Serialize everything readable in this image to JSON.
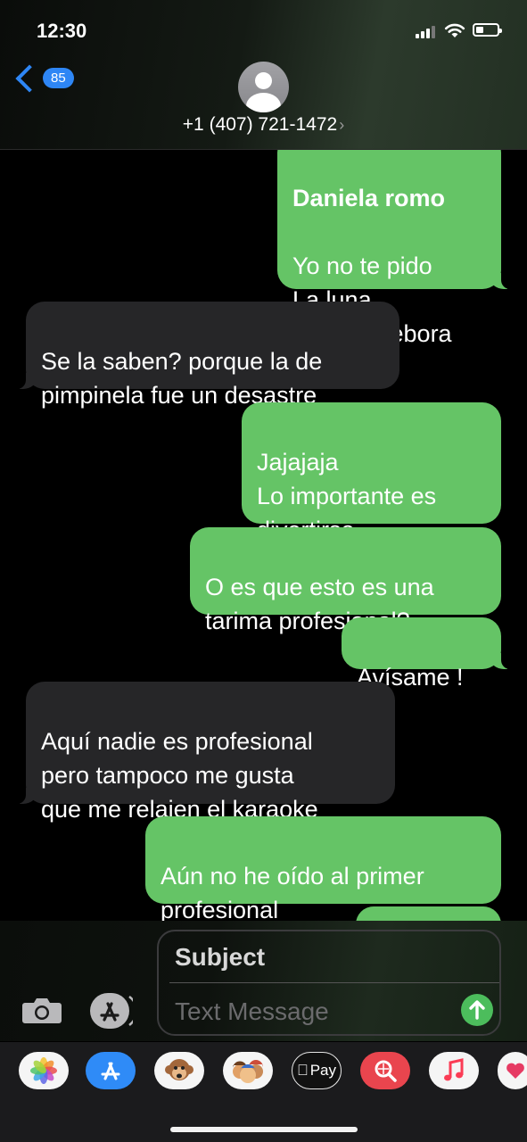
{
  "status_bar": {
    "time": "12:30"
  },
  "header": {
    "back_count": "85",
    "contact": "+1 (407) 721-1472",
    "chevron": "›"
  },
  "messages": [
    {
      "side": "sent",
      "first_line": "Daniela romo",
      "text": "Yo no te pido\nLa luna\nMaru y Debora"
    },
    {
      "side": "received",
      "text": "Se la saben? porque la de\npimpinela fue un desastre"
    },
    {
      "side": "sent",
      "text": "Jajajaja\nLo importante es\ndivertirse"
    },
    {
      "side": "sent",
      "text": "O es que esto es una\ntarima profesional?"
    },
    {
      "side": "sent",
      "text": "Avísame !"
    },
    {
      "side": "received",
      "text": "Aquí nadie es profesional\npero tampoco me gusta\nque me relajen el karaoke"
    },
    {
      "side": "sent",
      "text": "Aún no he oído al primer\nprofesional"
    }
  ],
  "composer": {
    "subject_placeholder": "Subject",
    "message_placeholder": "Text Message"
  },
  "app_tray": {
    "apps": [
      "photos-icon",
      "app-store-icon",
      "animoji-icon",
      "memoji-icon",
      "apple-pay-icon",
      "web-images-icon",
      "music-icon",
      "digital-touch-icon"
    ],
    "apple_pay_label": "Pay"
  },
  "colors": {
    "sent_bubble": "#65c466",
    "received_bubble": "#262628",
    "accent_blue": "#2e86f5",
    "send_button": "#4cbd5c"
  }
}
